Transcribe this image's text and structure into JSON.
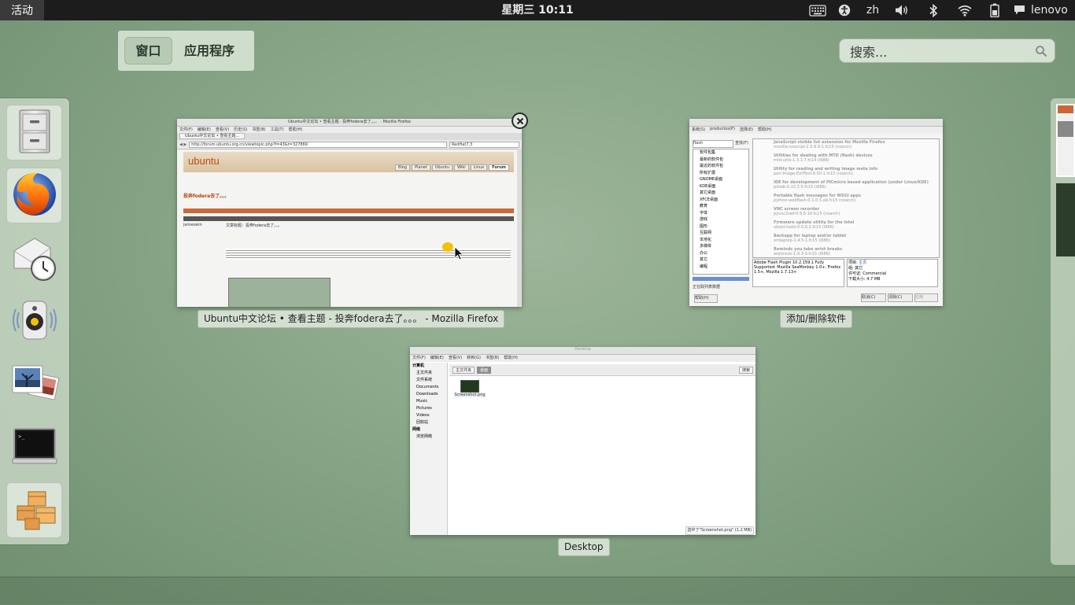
{
  "topbar": {
    "activities": "活动",
    "clock": "星期三 10:11",
    "input_method": "zh",
    "user": "lenovo",
    "icons": [
      "keyboard-icon",
      "accessibility-icon",
      "volume-icon",
      "bluetooth-icon",
      "wifi-icon",
      "battery-icon",
      "chat-icon"
    ]
  },
  "overview": {
    "tab_windows": "窗口",
    "tab_apps": "应用程序",
    "search_placeholder": "搜索..."
  },
  "dash": {
    "items": [
      {
        "name": "file-cabinet-icon"
      },
      {
        "name": "firefox-icon"
      },
      {
        "name": "mail-clock-icon"
      },
      {
        "name": "speaker-icon"
      },
      {
        "name": "photos-icon"
      },
      {
        "name": "terminal-icon"
      },
      {
        "name": "package-icon"
      }
    ]
  },
  "windows": {
    "firefox": {
      "caption": "Ubuntu中文论坛 • 查看主题 - 投奔fodera去了。。。 - Mozilla Firefox",
      "titlebar": "Ubuntu中文论坛 • 查看主题 - 投奔fodera去了。。。 - Mozilla Firefox",
      "menu": [
        "文件(F)",
        "编辑(E)",
        "查看(V)",
        "历史(S)",
        "书签(B)",
        "工具(T)",
        "帮助(H)"
      ],
      "tab": "Ubuntu中文论坛 • 查看主题...",
      "url": "http://forum.ubuntu.org.cn/viewtopic.php?f=43&t=327869",
      "search": "RedHat7.3",
      "logo": "ubuntu",
      "nav": [
        "Blog",
        "Planet",
        "Ubuntu",
        "Wiki",
        "Linux",
        "Forum"
      ],
      "topic": "投奔fodera去了。。。",
      "post_title": "文章标题：投奔fodera去了。。。",
      "author": "jameswin"
    },
    "software": {
      "caption": "添加/删除软件",
      "menu": [
        "系统(S)",
        "productos(P)",
        "选择(E)",
        "帮助(H)"
      ],
      "filter": "flash",
      "filter_btn": "查找(F)",
      "categories": [
        "软件包集",
        "最新的软件包",
        "最近的软件包",
        "所有扩展",
        "GNOME桌面",
        "KDE桌面",
        "其它桌面",
        "XFCE桌面",
        "教育",
        "字体",
        "游戏",
        "图形",
        "互联网",
        "本地化",
        "多媒体",
        "办公",
        "其它",
        "编程"
      ],
      "packages": [
        {
          "title": "JavaScript visible list extension for Mozilla Firefox",
          "ver": "mozilla-noscript-2.0.9.9-1.fc15 (noarch)"
        },
        {
          "title": "Utilities for dealing with MTD (flash) devices",
          "ver": "mtd-utils-1.3.1-7.fc14 (i686)"
        },
        {
          "title": "Utility for reading and writing image meta info",
          "ver": "perl-Image-ExifTool-8.50-1.fc15 (noarch)"
        },
        {
          "title": "IDE for development of PICmicro based application (under Linux/KDE)",
          "ver": "piklab-0.15.2-5.fc15 (i686)"
        },
        {
          "title": "Portable flash messages for WSGI apps",
          "ver": "python-webflash-0.1-0.5.a9.fc15 (noarch)"
        },
        {
          "title": "VNC screen recorder",
          "ver": "pyvnc2swf-0.9.5-10.fc15 (noarch)"
        },
        {
          "title": "Firmware update utility for the Intel",
          "ver": "uboot-tools-0-0.6.2.fc15 (i686)"
        },
        {
          "title": "Backapp for laptop and/or tablet",
          "ver": "xmlaptop-1.4.5-1.fc15 (i686)"
        },
        {
          "title": "Reminds you take wrist breaks",
          "ver": "workrave-1.9.3-3.fc15 (i686)"
        }
      ],
      "description": "Adobe Flash Plugin 10.2.159.1 Fully Supported: Mozilla SeaMonkey 1.0+, Firefox 1.5+, Mozilla 1.7.13+",
      "details": [
        {
          "k": "项目:",
          "v": "主页"
        },
        {
          "k": "组:",
          "v": "其它"
        },
        {
          "k": "许可证:",
          "v": "Commercial"
        },
        {
          "k": "下载大小:",
          "v": "4.7 MB"
        }
      ],
      "btn_cancel": "取消(C)",
      "btn_clear": "清除(C)",
      "btn_apply": "应用",
      "btn_help": "帮助(H)",
      "status": "正在取列表数据"
    },
    "desktop": {
      "caption": "Desktop",
      "titlebar": "Desktop",
      "menu": [
        "文件(F)",
        "编辑(E)",
        "查看(V)",
        "转到(G)",
        "书签(B)",
        "帮助(H)"
      ],
      "sidebar_heading": "计算机",
      "sidebar": [
        "主文件夹",
        "文件系统",
        "Documents",
        "Downloads",
        "Music",
        "Pictures",
        "Videos",
        "回收站"
      ],
      "network_heading": "网络",
      "network": [
        "浏览网络"
      ],
      "path": [
        "主文件夹",
        "桌面"
      ],
      "search_btn": "搜索",
      "file": "Screenshot.png",
      "status": "选中了\"Screenshot.png\" (1.2 MB)"
    }
  }
}
